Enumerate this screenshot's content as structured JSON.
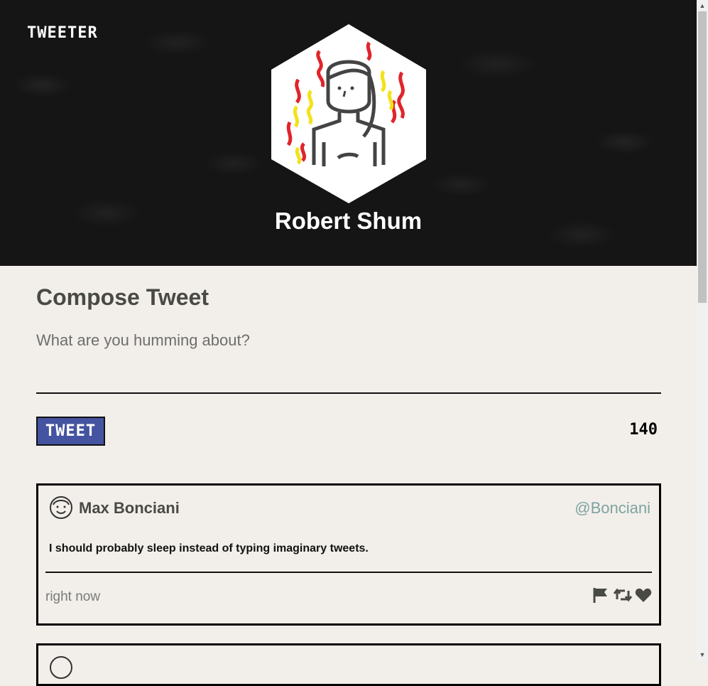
{
  "app": {
    "brand": "TWEETER"
  },
  "profile": {
    "name": "Robert Shum"
  },
  "compose": {
    "title": "Compose Tweet",
    "placeholder": "What are you humming about?",
    "button_label": "TWEET",
    "char_count": "140"
  },
  "tweets": [
    {
      "name": "Max Bonciani",
      "handle": "@Bonciani",
      "text": "I should probably sleep instead of typing imaginary tweets.",
      "time": "right now",
      "actions": [
        "flag-icon",
        "retweet-icon",
        "heart-icon"
      ]
    }
  ],
  "colors": {
    "header_bg": "#151515",
    "page_bg": "#f2efea",
    "button_bg": "#4454a0",
    "handle": "#7fa3a0",
    "text_dark": "#4a4a45"
  }
}
